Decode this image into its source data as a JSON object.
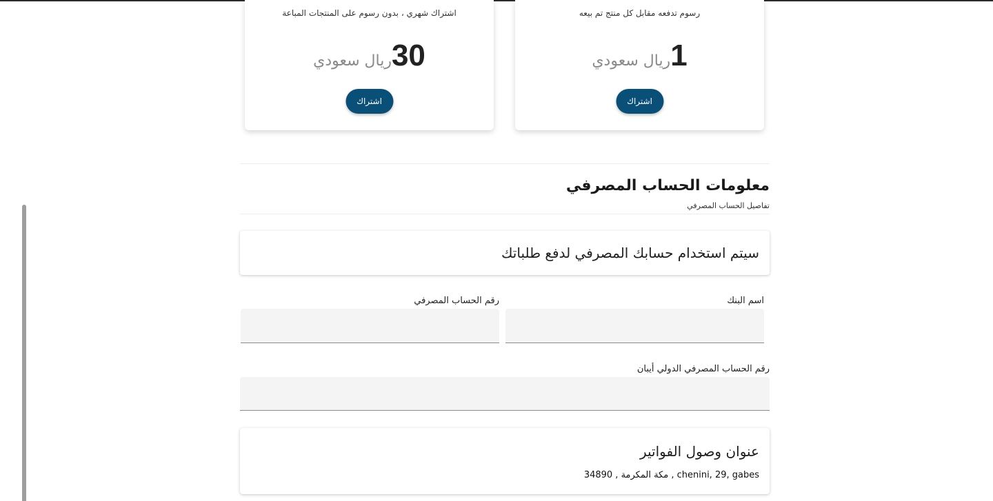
{
  "plans": [
    {
      "description": "اشتراك شهري ، بدون رسوم على المنتجات المباعة",
      "amount": "30",
      "currency": "ريال سعودي",
      "button_label": "اشتراك"
    },
    {
      "description": "رسوم تدفعه مقابل كل منتج تم بيعه",
      "amount": "1",
      "currency": "ريال سعودي",
      "button_label": "اشتراك"
    }
  ],
  "bank_section": {
    "title": "معلومات الحساب المصرفي",
    "subtitle": "تفاصيل الحساب المصرفي",
    "notice": "سيتم استخدام حسابك المصرفي لدفع طلباتك",
    "fields": {
      "bank_name_label": "اسم البنك",
      "bank_name_value": "",
      "account_number_label": "رقم الحساب المصرفي",
      "account_number_value": "",
      "iban_label": "رقم الحساب المصرفي الدولي أيبان",
      "iban_value": ""
    }
  },
  "billing": {
    "title": "عنوان وصول الفواتير",
    "address": "chenini, 29, gabes , مكة المكرمة , 34890"
  }
}
